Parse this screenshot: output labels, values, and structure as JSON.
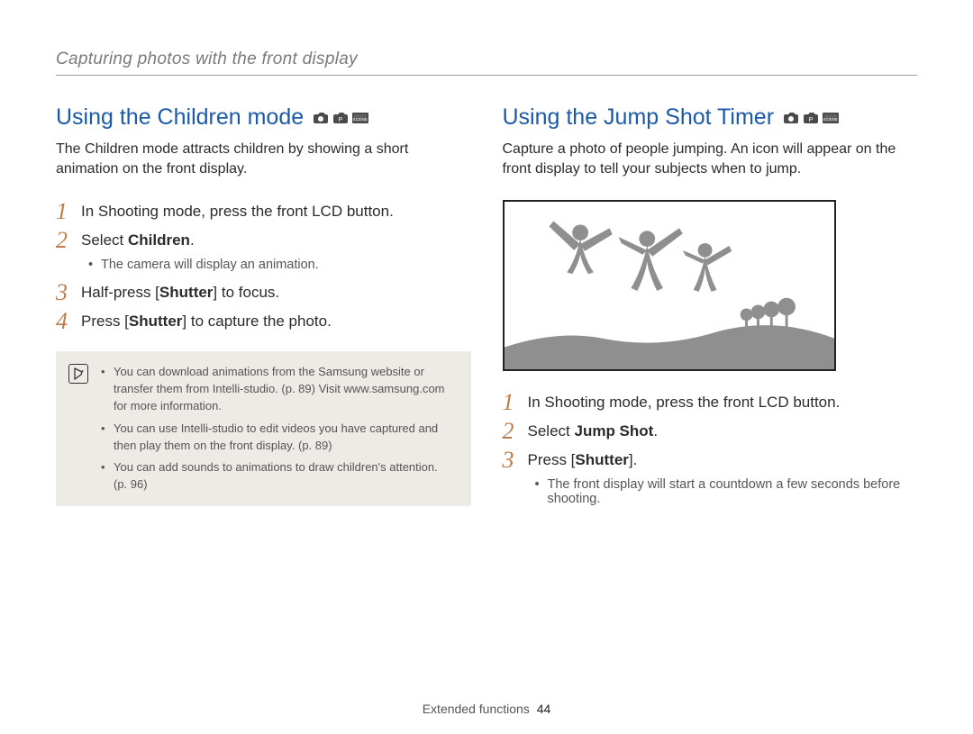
{
  "breadcrumb": "Capturing photos with the front display",
  "left": {
    "title": "Using the Children mode",
    "intro": "The Children mode attracts children by showing a short animation on the front display.",
    "steps": [
      {
        "num": "1",
        "text": "In Shooting mode, press the front LCD button."
      },
      {
        "num": "2",
        "prefix": "Select ",
        "bold": "Children",
        "suffix": ".",
        "bullets": [
          "The camera will display an animation."
        ]
      },
      {
        "num": "3",
        "prefix": "Half-press [",
        "bold": "Shutter",
        "suffix": "] to focus."
      },
      {
        "num": "4",
        "prefix": "Press [",
        "bold": "Shutter",
        "suffix": "] to capture the photo."
      }
    ],
    "notes": [
      "You can download animations from the Samsung website or transfer them from Intelli-studio. (p. 89) Visit www.samsung.com for more information.",
      "You can use Intelli-studio to edit videos you have captured and then play them on the front display. (p. 89)",
      "You can add sounds to animations to draw children's attention. (p. 96)"
    ]
  },
  "right": {
    "title": "Using the Jump Shot Timer",
    "intro": "Capture a photo of people jumping. An icon will appear on the front display to tell your subjects when to jump.",
    "steps": [
      {
        "num": "1",
        "text": "In Shooting mode, press the front LCD button."
      },
      {
        "num": "2",
        "prefix": "Select ",
        "bold": "Jump Shot",
        "suffix": "."
      },
      {
        "num": "3",
        "prefix": "Press [",
        "bold": "Shutter",
        "suffix": "].",
        "bullets": [
          "The front display will start a countdown a few seconds before shooting."
        ]
      }
    ]
  },
  "footer": {
    "label": "Extended functions",
    "page": "44"
  }
}
